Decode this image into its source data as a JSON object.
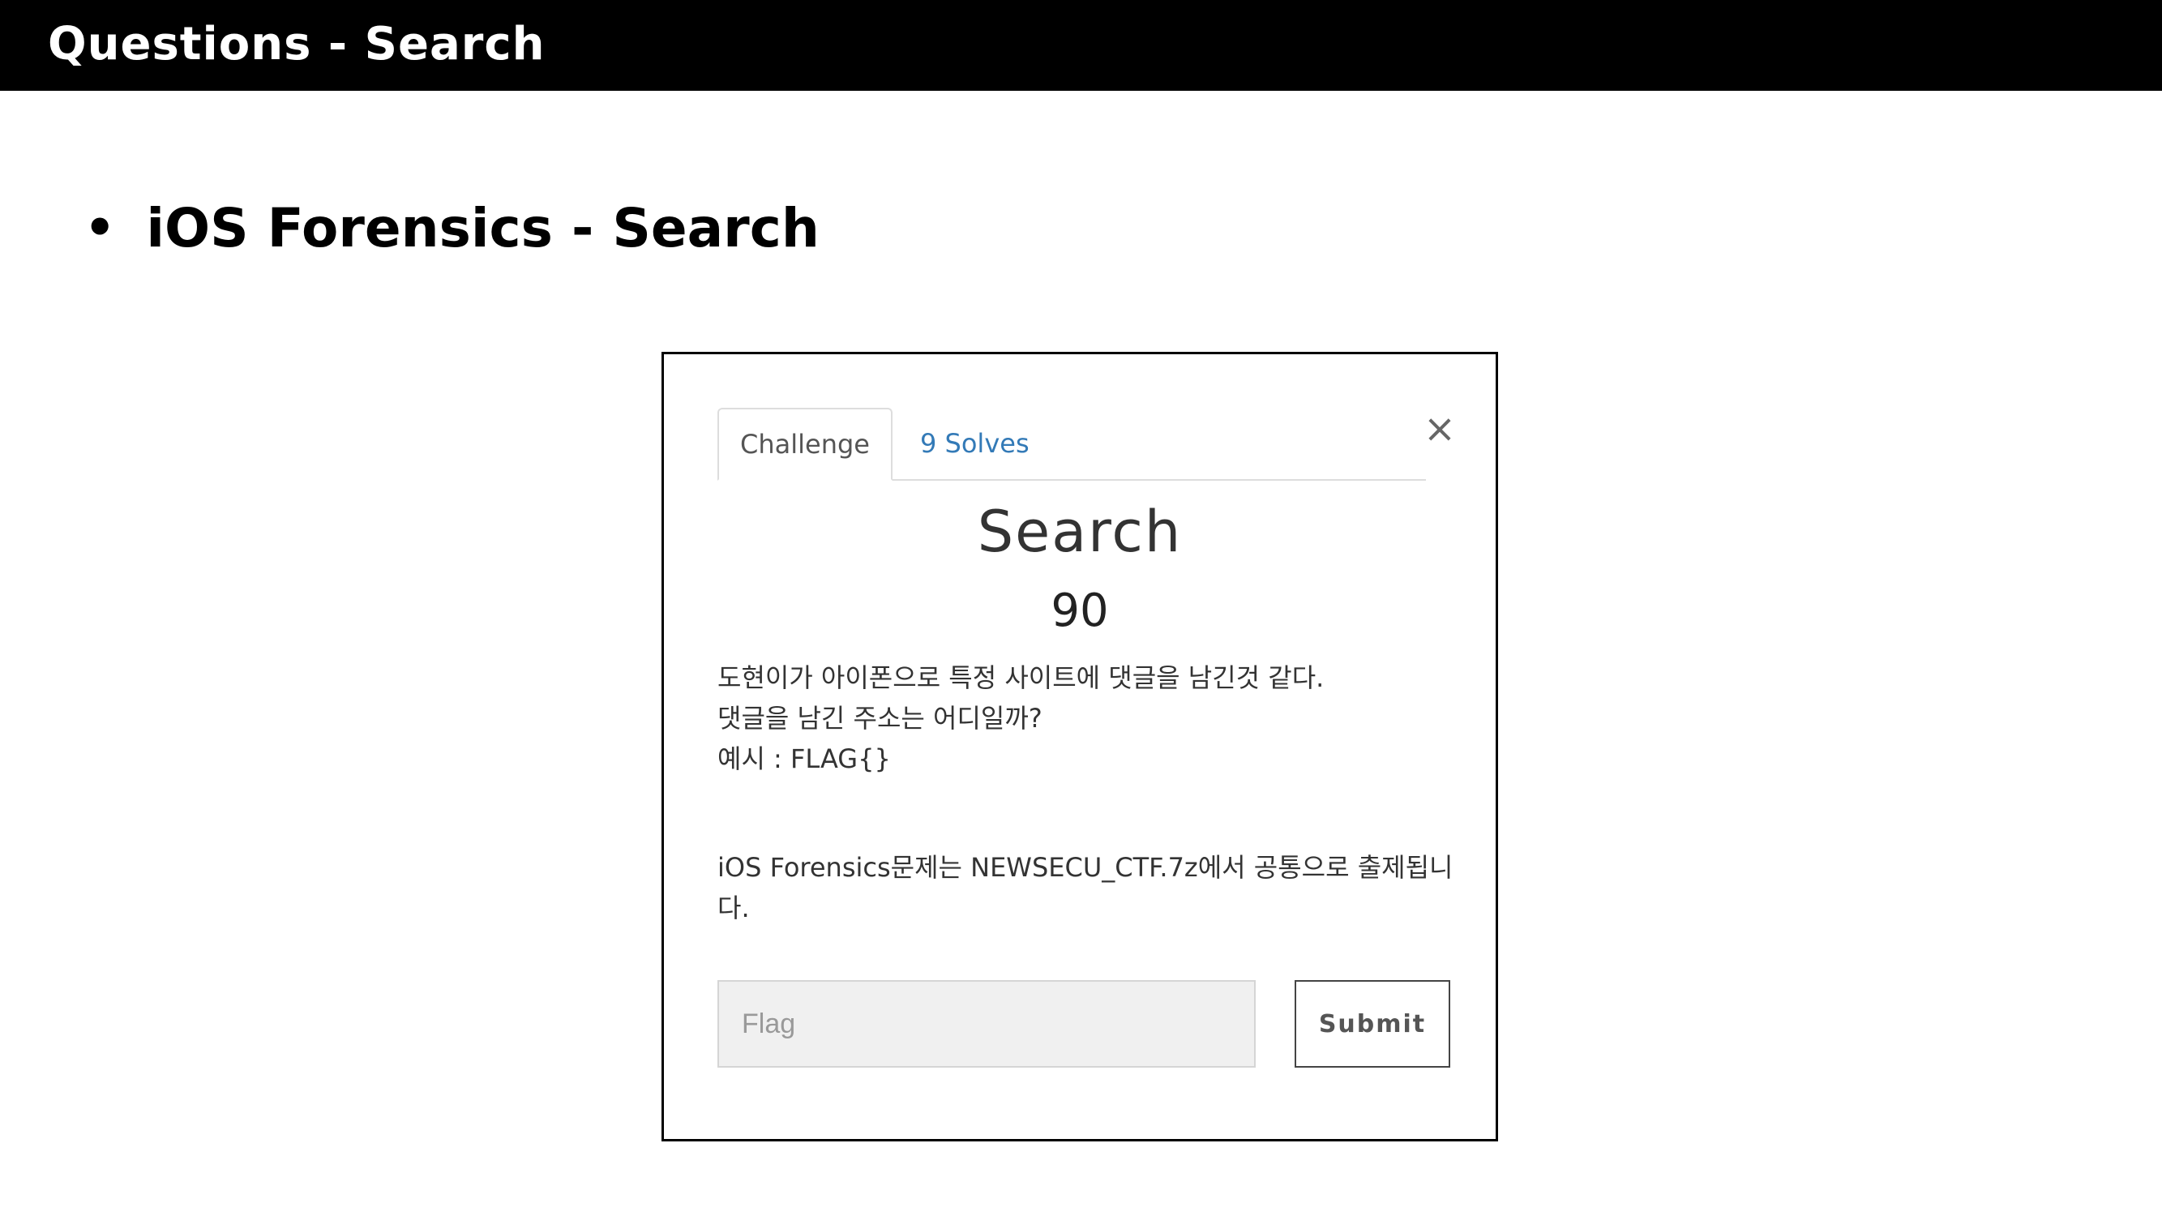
{
  "header": {
    "title": "Questions - Search"
  },
  "bullet": {
    "symbol": "•",
    "text": "iOS Forensics - Search"
  },
  "modal": {
    "tabs": [
      {
        "label": "Challenge",
        "active": true
      },
      {
        "label": "9 Solves",
        "active": false
      }
    ],
    "close_symbol": "×",
    "challenge_name": "Search",
    "challenge_value": "90",
    "description": {
      "line1": "도현이가 아이폰으로 특정 사이트에 댓글을 남긴것 같다.",
      "line2": "댓글을 남긴 주소는 어디일까?",
      "line3": "예시 : FLAG{}",
      "note": "iOS Forensics문제는 NEWSECU_CTF.7z에서 공통으로 출제됩니다."
    },
    "flag_input": {
      "value": "",
      "placeholder": "Flag"
    },
    "submit_label": "Submit"
  },
  "colors": {
    "header_bg": "#000000",
    "tab_link": "#337ab7",
    "input_bg": "#f0f0f0"
  }
}
